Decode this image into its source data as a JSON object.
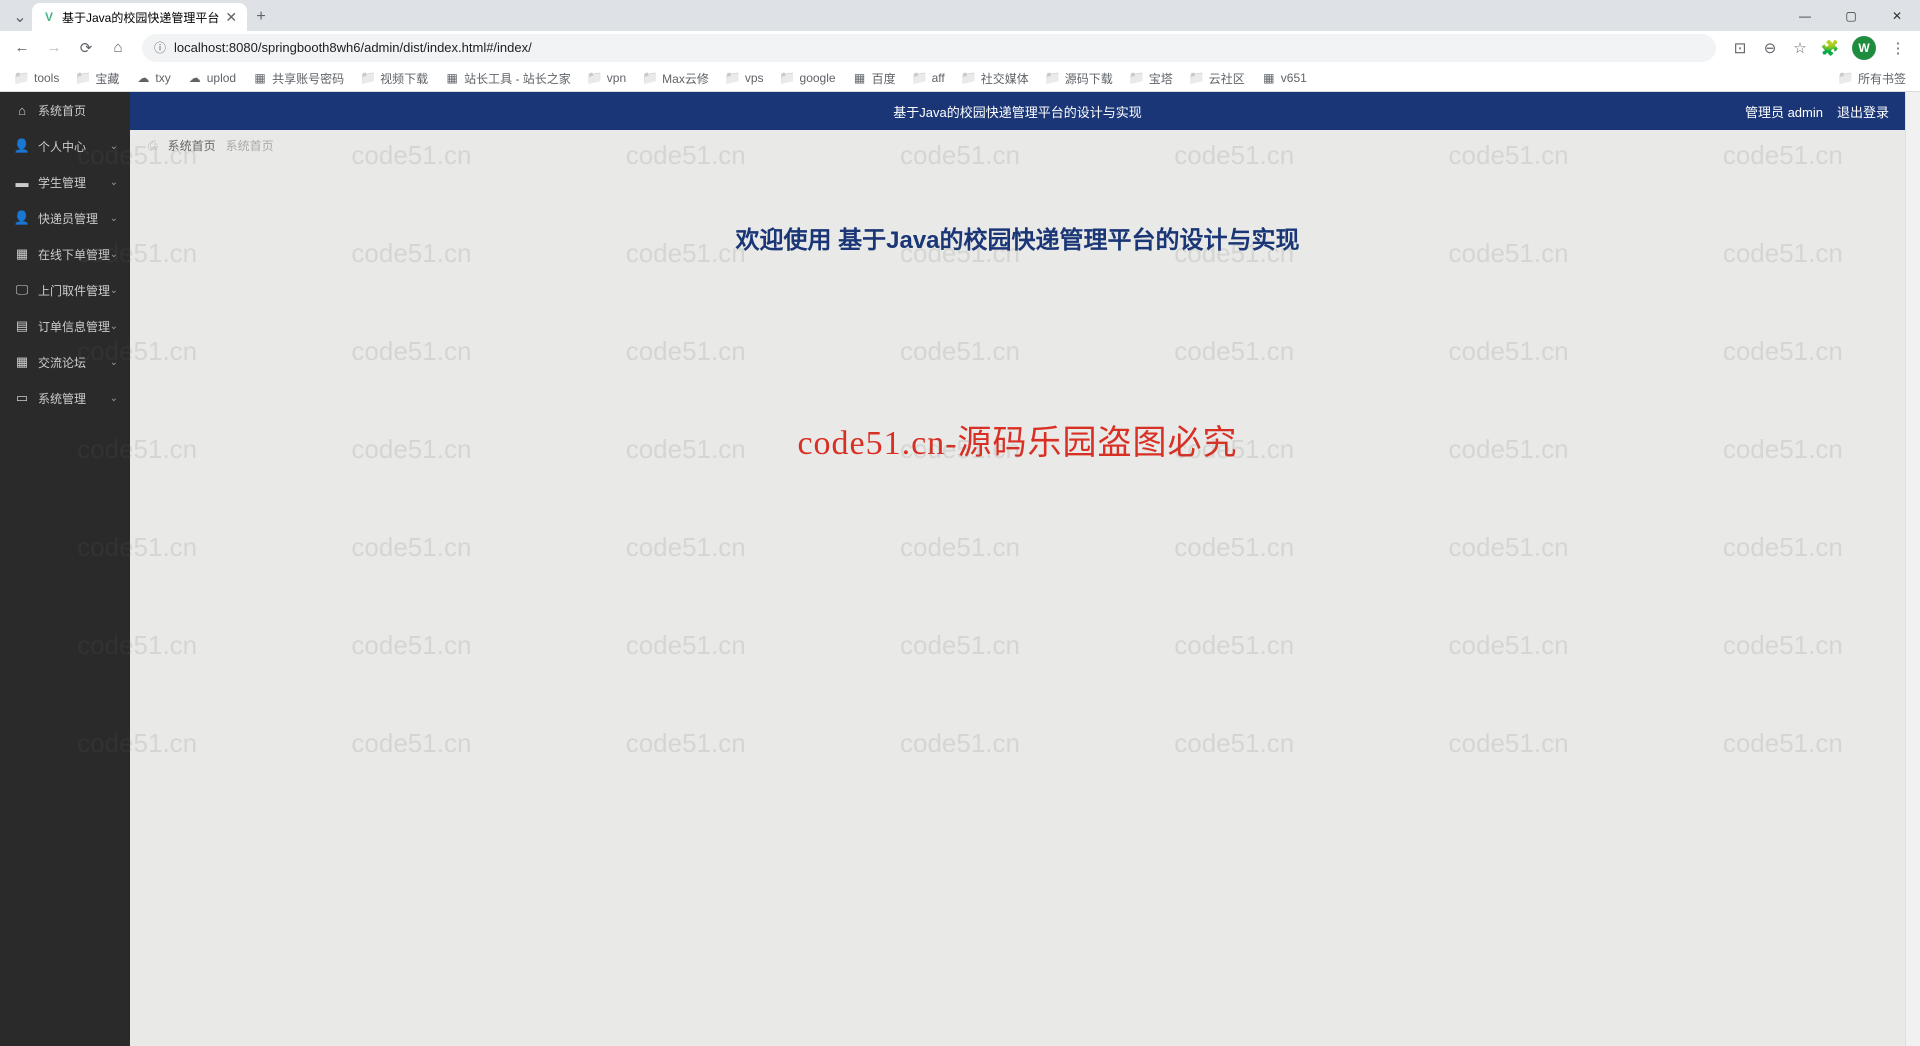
{
  "browser": {
    "tab_title": "基于Java的校园快递管理平台",
    "url": "localhost:8080/springbooth8wh6/admin/dist/index.html#/index/",
    "window_controls": {
      "minimize": "—",
      "maximize": "▢",
      "close": "✕"
    },
    "profile_letter": "W"
  },
  "bookmarks": [
    {
      "label": "tools",
      "type": "folder"
    },
    {
      "label": "宝藏",
      "type": "folder"
    },
    {
      "label": "txy",
      "type": "cloud"
    },
    {
      "label": "uplod",
      "type": "cloud"
    },
    {
      "label": "共享账号密码",
      "type": "page"
    },
    {
      "label": "视频下载",
      "type": "folder"
    },
    {
      "label": "站长工具 - 站长之家",
      "type": "page"
    },
    {
      "label": "vpn",
      "type": "folder"
    },
    {
      "label": "Max云修",
      "type": "folder"
    },
    {
      "label": "vps",
      "type": "folder"
    },
    {
      "label": "google",
      "type": "folder"
    },
    {
      "label": "百度",
      "type": "page"
    },
    {
      "label": "aff",
      "type": "folder"
    },
    {
      "label": "社交媒体",
      "type": "folder"
    },
    {
      "label": "源码下载",
      "type": "folder"
    },
    {
      "label": "宝塔",
      "type": "folder"
    },
    {
      "label": "云社区",
      "type": "folder"
    },
    {
      "label": "v651",
      "type": "page"
    }
  ],
  "bookmarks_right": "所有书签",
  "sidebar": {
    "items": [
      {
        "label": "系统首页",
        "icon": "home",
        "expandable": false
      },
      {
        "label": "个人中心",
        "icon": "user",
        "expandable": true
      },
      {
        "label": "学生管理",
        "icon": "book",
        "expandable": true
      },
      {
        "label": "快递员管理",
        "icon": "courier",
        "expandable": true
      },
      {
        "label": "在线下单管理",
        "icon": "grid",
        "expandable": true
      },
      {
        "label": "上门取件管理",
        "icon": "monitor",
        "expandable": true
      },
      {
        "label": "订单信息管理",
        "icon": "chart",
        "expandable": true
      },
      {
        "label": "交流论坛",
        "icon": "grid",
        "expandable": true
      },
      {
        "label": "系统管理",
        "icon": "bookmark",
        "expandable": true
      }
    ]
  },
  "header": {
    "title": "基于Java的校园快递管理平台的设计与实现",
    "admin_label": "管理员 admin",
    "logout_label": "退出登录"
  },
  "breadcrumb": {
    "items": [
      "系统首页",
      "系统首页"
    ]
  },
  "content": {
    "welcome_prefix": "欢迎使用 ",
    "welcome_title": "基于Java的校园快递管理平台的设计与实现",
    "center_text": "code51.cn-源码乐园盗图必究"
  },
  "watermark": "code51.cn"
}
